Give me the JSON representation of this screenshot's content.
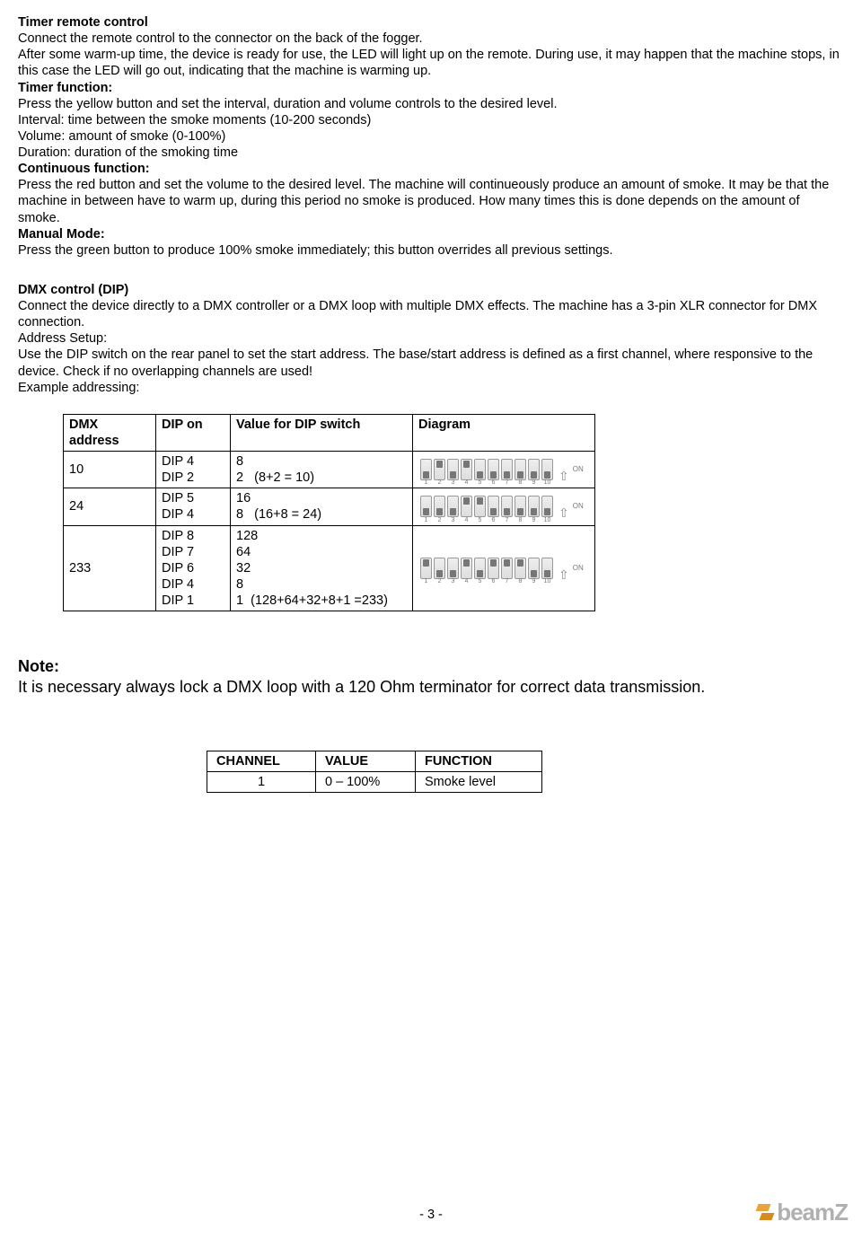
{
  "s1": {
    "h": "Timer remote control",
    "p1": "Connect the remote control to the connector on the back of the fogger.",
    "p2": "After some warm-up time, the device is ready for use, the LED will light up on the remote. During use, it may happen that the machine stops, in this case the LED will go out, indicating that the machine is warming up.",
    "h2": "Timer function:",
    "p3": "Press the yellow button and set the interval, duration and volume controls to the desired level.",
    "p4": "Interval: time between the smoke moments (10-200 seconds)",
    "p5": "Volume: amount of smoke (0-100%)",
    "p6": "Duration: duration of the smoking time",
    "h3": "Continuous function:",
    "p7": "Press the red button and set the volume to the desired level. The machine will continueously produce an amount of smoke. It may be that the machine in between have to warm up, during this period no smoke is produced. How many times this is done depends on the amount of smoke.",
    "h4": "Manual Mode:",
    "p8": "Press the green button to produce 100% smoke immediately; this button overrides all previous settings."
  },
  "s2": {
    "h": "DMX control (DIP)",
    "p1": "Connect the device directly to a DMX controller or a DMX loop with multiple DMX effects. The machine has a 3-pin XLR connector for DMX connection.",
    "p2": "Address Setup:",
    "p3": "Use the DIP switch on the rear panel to set the start address. The base/start address is defined as a first channel, where responsive to the device. Check if no overlapping channels are used!",
    "p4": "Example addressing:"
  },
  "dmx_table": {
    "headers": [
      "DMX address",
      "DIP on",
      "Value for DIP switch",
      "Diagram"
    ],
    "rows": [
      {
        "addr": "10",
        "dips": "DIP 4\nDIP 2",
        "vals": "8\n2   (8+2 = 10)",
        "switchesUp": [
          2,
          4
        ]
      },
      {
        "addr": "24",
        "dips": "DIP 5\nDIP 4",
        "vals": "16\n8   (16+8 = 24)",
        "switchesUp": [
          4,
          5
        ]
      },
      {
        "addr": "233",
        "dips": "DIP 8\nDIP 7\nDIP 6\nDIP 4\nDIP 1",
        "vals": "128\n64\n32\n8\n1  (128+64+32+8+1 =233)",
        "switchesUp": [
          1,
          4,
          6,
          7,
          8
        ]
      }
    ],
    "onLabel": "ON"
  },
  "note": {
    "h": "Note:",
    "p": "It is necessary always lock a DMX loop with a 120 Ohm terminator for correct data transmission."
  },
  "chan_table": {
    "headers": [
      "CHANNEL",
      "VALUE",
      "FUNCTION"
    ],
    "row": [
      "1",
      "0 – 100%",
      "Smoke level"
    ]
  },
  "footer": "- 3 -",
  "logo": "beamZ"
}
